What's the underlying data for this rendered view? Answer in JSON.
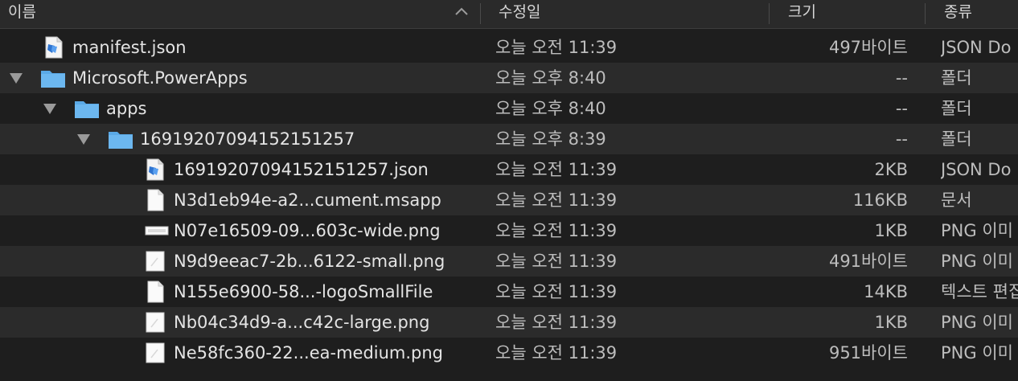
{
  "columns": {
    "name": "이름",
    "modified": "수정일",
    "size": "크기",
    "kind": "종류"
  },
  "rows": [
    {
      "name": "manifest.json",
      "date": "오늘 오전 11:39",
      "size": "497바이트",
      "kind": "JSON Do",
      "icon": "json-file-icon",
      "depth": 0,
      "disclosure": false
    },
    {
      "name": "Microsoft.PowerApps",
      "date": "오늘 오후 8:40",
      "size": "--",
      "kind": "폴더",
      "icon": "folder-icon",
      "depth": 0,
      "disclosure": true
    },
    {
      "name": "apps",
      "date": "오늘 오후 8:40",
      "size": "--",
      "kind": "폴더",
      "icon": "folder-icon",
      "depth": 1,
      "disclosure": true
    },
    {
      "name": "16919207094152151257",
      "date": "오늘 오후 8:39",
      "size": "--",
      "kind": "폴더",
      "icon": "folder-icon",
      "depth": 2,
      "disclosure": true
    },
    {
      "name": "16919207094152151257.json",
      "date": "오늘 오전 11:39",
      "size": "2KB",
      "kind": "JSON Do",
      "icon": "json-file-icon",
      "depth": 3,
      "disclosure": false
    },
    {
      "name": "N3d1eb94e-a2...cument.msapp",
      "date": "오늘 오전 11:39",
      "size": "116KB",
      "kind": "문서",
      "icon": "document-file-icon",
      "depth": 3,
      "disclosure": false
    },
    {
      "name": "N07e16509-09...603c-wide.png",
      "date": "오늘 오전 11:39",
      "size": "1KB",
      "kind": "PNG 이미",
      "icon": "wide-image-icon",
      "depth": 3,
      "disclosure": false
    },
    {
      "name": "N9d9eeac7-2b...6122-small.png",
      "date": "오늘 오전 11:39",
      "size": "491바이트",
      "kind": "PNG 이미",
      "icon": "image-file-icon",
      "depth": 3,
      "disclosure": false
    },
    {
      "name": "N155e6900-58...-logoSmallFile",
      "date": "오늘 오전 11:39",
      "size": "14KB",
      "kind": "텍스트 편집",
      "icon": "document-file-icon",
      "depth": 3,
      "disclosure": false
    },
    {
      "name": "Nb04c34d9-a...c42c-large.png",
      "date": "오늘 오전 11:39",
      "size": "1KB",
      "kind": "PNG 이미",
      "icon": "image-file-icon",
      "depth": 3,
      "disclosure": false
    },
    {
      "name": "Ne58fc360-22...ea-medium.png",
      "date": "오늘 오전 11:39",
      "size": "951바이트",
      "kind": "PNG 이미",
      "icon": "image-file-icon",
      "depth": 3,
      "disclosure": false
    }
  ]
}
